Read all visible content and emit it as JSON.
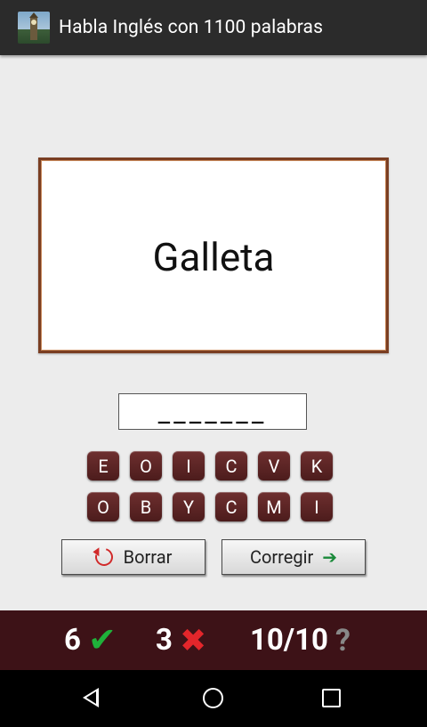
{
  "app": {
    "title": "Habla Inglés con 1100 palabras"
  },
  "card": {
    "word": "Galleta"
  },
  "answer": {
    "text": "_______"
  },
  "keyboard": {
    "row1": [
      "E",
      "O",
      "I",
      "C",
      "V",
      "K"
    ],
    "row2": [
      "O",
      "B",
      "Y",
      "C",
      "M",
      "I"
    ]
  },
  "actions": {
    "clear_label": "Borrar",
    "check_label": "Corregir"
  },
  "score": {
    "correct": "6",
    "wrong": "3",
    "progress": "10/10"
  },
  "colors": {
    "key": "#5b2424",
    "score_bar": "#3d1217",
    "correct": "#1fb13a",
    "wrong": "#e3262b",
    "card_border": "#7a3e22"
  }
}
